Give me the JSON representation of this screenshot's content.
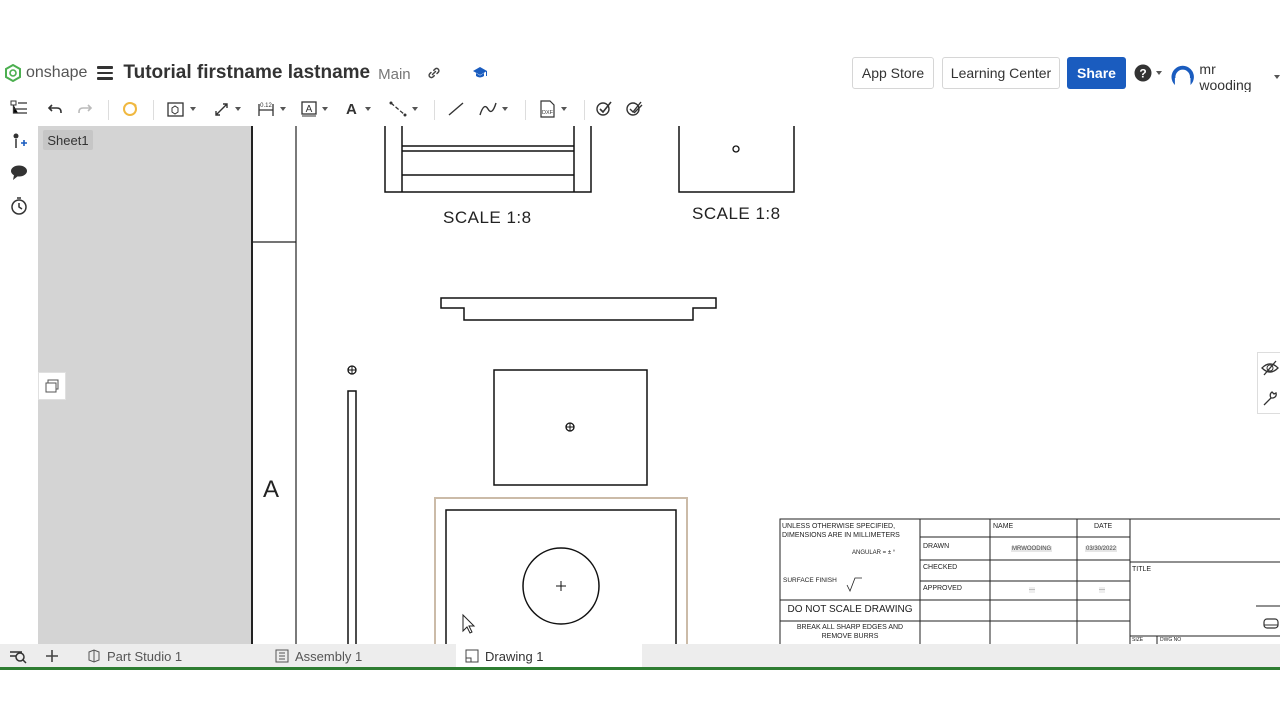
{
  "header": {
    "logo_text": "onshape",
    "document_title": "Tutorial firstname lastname",
    "branch": "Main",
    "app_store_label": "App Store",
    "learning_center_label": "Learning Center",
    "share_label": "Share",
    "user_name": "mr wooding",
    "accent_color": "#1a5cbf"
  },
  "toolbar": {
    "icons": [
      "undo-icon",
      "redo-icon",
      "regenerate-icon",
      "insert-view-icon",
      "projected-view-icon",
      "dimension-icon",
      "note-icon",
      "text-icon",
      "centerline-icon",
      "line-icon",
      "spline-icon",
      "export-dxf-icon",
      "check-icon",
      "check-all-icon"
    ]
  },
  "sidebar": {
    "sheet_label": "Sheet1"
  },
  "drawing": {
    "scale_label_1": "SCALE 1:8",
    "scale_label_2": "SCALE 1:8",
    "zone_letter": "A",
    "title_block": {
      "general_note": "UNLESS OTHERWISE SPECIFIED, DIMENSIONS ARE IN MILLIMETERS",
      "angular_note": "ANGULAR = ± °",
      "surface_finish": "SURFACE FINISH",
      "do_not_scale": "DO NOT SCALE DRAWING",
      "break_edges": "BREAK ALL SHARP EDGES AND REMOVE BURRS",
      "col_name": "NAME",
      "col_date": "DATE",
      "row_drawn": "DRAWN",
      "row_checked": "CHECKED",
      "row_approved": "APPROVED",
      "drawn_name": "MRWOODING",
      "drawn_date": "03/30/2022",
      "approved_name": "—",
      "approved_date": "—",
      "title_label": "TITLE",
      "size_label": "SIZE",
      "dwg_no_label": "DWG NO"
    }
  },
  "bottom_tabs": [
    {
      "label": "Part Studio 1"
    },
    {
      "label": "Assembly 1"
    },
    {
      "label": "Drawing 1"
    }
  ]
}
